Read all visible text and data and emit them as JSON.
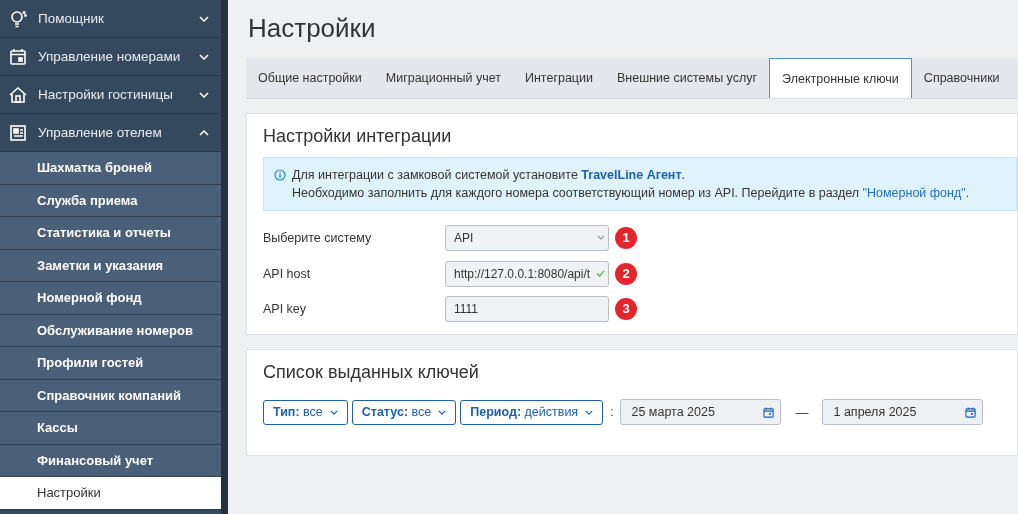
{
  "sidebar": {
    "sections": [
      {
        "label": "Помощник",
        "expanded": false
      },
      {
        "label": "Управление номерами",
        "expanded": false
      },
      {
        "label": "Настройки гостиницы",
        "expanded": false
      },
      {
        "label": "Управление отелем",
        "expanded": true
      }
    ],
    "items": [
      {
        "label": "Шахматка броней",
        "selected": false
      },
      {
        "label": "Служба приема",
        "selected": false
      },
      {
        "label": "Статистика и отчеты",
        "selected": false
      },
      {
        "label": "Заметки и указания",
        "selected": false
      },
      {
        "label": "Номерной фонд",
        "selected": false
      },
      {
        "label": "Обслуживание номеров",
        "selected": false
      },
      {
        "label": "Профили гостей",
        "selected": false
      },
      {
        "label": "Справочник компаний",
        "selected": false
      },
      {
        "label": "Кассы",
        "selected": false
      },
      {
        "label": "Финансовый учет",
        "selected": false
      },
      {
        "label": "Настройки",
        "selected": true
      }
    ]
  },
  "page_title": "Настройки",
  "tabs": [
    {
      "label": "Общие настройки",
      "selected": false
    },
    {
      "label": "Миграционный учет",
      "selected": false
    },
    {
      "label": "Интеграции",
      "selected": false
    },
    {
      "label": "Внешние системы услуг",
      "selected": false
    },
    {
      "label": "Электронные ключи",
      "selected": true
    },
    {
      "label": "Справочники",
      "selected": false
    }
  ],
  "integration": {
    "title": "Настройки интеграции",
    "info": {
      "line1": "Для интеграции с замковой системой установите **TravelLine Агент**.",
      "line2_before": "Необходимо заполнить для каждого номера соответствующий номер из API. Перейдите в раздел ",
      "link": "\"Номерной фонд\"",
      "line2_after": "."
    },
    "fields": [
      {
        "kind": "select",
        "label": "Выберите систему",
        "value": "API",
        "badge": "1"
      },
      {
        "kind": "input",
        "label": "API host",
        "value": "http://127.0.0.1:8080/api/t",
        "valid": true,
        "badge": "2"
      },
      {
        "kind": "input",
        "label": "API key",
        "value": "1111",
        "valid": false,
        "badge": "3"
      }
    ]
  },
  "keys": {
    "title": "Список выданных ключей",
    "filters": [
      "**Тип:** все",
      "**Статус:** все",
      "**Период:** действия"
    ],
    "separator": ":",
    "date_from": "25 марта 2025",
    "dash": "—",
    "date_to": "1 апреля 2025"
  }
}
